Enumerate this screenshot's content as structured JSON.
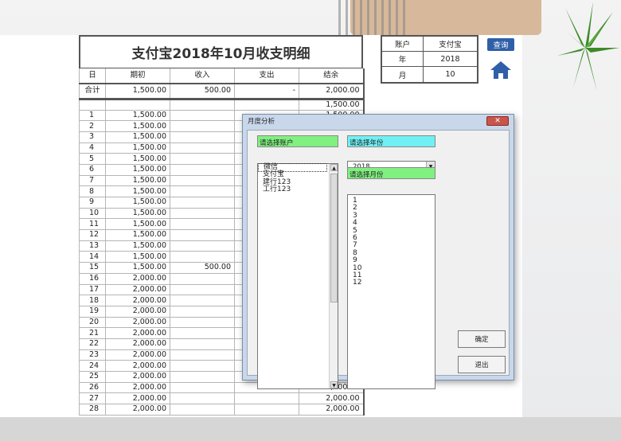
{
  "sheet": {
    "title": "支付宝2018年10月收支明细",
    "headers": [
      "日",
      "期初",
      "收入",
      "支出",
      "结余"
    ],
    "summary": {
      "label": "合计",
      "opening": "1,500.00",
      "income": "500.00",
      "expense": "-",
      "balance": "2,000.00"
    },
    "blank_row_balance": "1,500.00",
    "rows": [
      {
        "day": "1",
        "opening": "1,500.00",
        "income": "",
        "balance": "1,500.00"
      },
      {
        "day": "2",
        "opening": "1,500.00",
        "income": "",
        "balance": ""
      },
      {
        "day": "3",
        "opening": "1,500.00",
        "income": "",
        "balance": ""
      },
      {
        "day": "4",
        "opening": "1,500.00",
        "income": "",
        "balance": ""
      },
      {
        "day": "5",
        "opening": "1,500.00",
        "income": "",
        "balance": ""
      },
      {
        "day": "6",
        "opening": "1,500.00",
        "income": "",
        "balance": ""
      },
      {
        "day": "7",
        "opening": "1,500.00",
        "income": "",
        "balance": ""
      },
      {
        "day": "8",
        "opening": "1,500.00",
        "income": "",
        "balance": ""
      },
      {
        "day": "9",
        "opening": "1,500.00",
        "income": "",
        "balance": ""
      },
      {
        "day": "10",
        "opening": "1,500.00",
        "income": "",
        "balance": ""
      },
      {
        "day": "11",
        "opening": "1,500.00",
        "income": "",
        "balance": ""
      },
      {
        "day": "12",
        "opening": "1,500.00",
        "income": "",
        "balance": ""
      },
      {
        "day": "13",
        "opening": "1,500.00",
        "income": "",
        "balance": ""
      },
      {
        "day": "14",
        "opening": "1,500.00",
        "income": "",
        "balance": ""
      },
      {
        "day": "15",
        "opening": "1,500.00",
        "income": "500.00",
        "balance": ""
      },
      {
        "day": "16",
        "opening": "2,000.00",
        "income": "",
        "balance": ""
      },
      {
        "day": "17",
        "opening": "2,000.00",
        "income": "",
        "balance": ""
      },
      {
        "day": "18",
        "opening": "2,000.00",
        "income": "",
        "balance": ""
      },
      {
        "day": "19",
        "opening": "2,000.00",
        "income": "",
        "balance": ""
      },
      {
        "day": "20",
        "opening": "2,000.00",
        "income": "",
        "balance": ""
      },
      {
        "day": "21",
        "opening": "2,000.00",
        "income": "",
        "balance": ""
      },
      {
        "day": "22",
        "opening": "2,000.00",
        "income": "",
        "balance": ""
      },
      {
        "day": "23",
        "opening": "2,000.00",
        "income": "",
        "balance": ""
      },
      {
        "day": "24",
        "opening": "2,000.00",
        "income": "",
        "balance": ""
      },
      {
        "day": "25",
        "opening": "2,000.00",
        "income": "",
        "balance": ""
      },
      {
        "day": "26",
        "opening": "2,000.00",
        "income": "",
        "balance": "2,000.00"
      },
      {
        "day": "27",
        "opening": "2,000.00",
        "income": "",
        "balance": "2,000.00"
      },
      {
        "day": "28",
        "opening": "2,000.00",
        "income": "",
        "balance": "2,000.00"
      }
    ]
  },
  "info": {
    "account_label": "账户",
    "account_value": "支付宝",
    "year_label": "年",
    "year_value": "2018",
    "month_label": "月",
    "month_value": "10"
  },
  "toolbar": {
    "query_label": "查询",
    "home_icon": "home-icon"
  },
  "dialog": {
    "title": "月度分析",
    "close_glyph": "✕",
    "account_label": "请选择账户",
    "accounts": [
      "微信",
      "支付宝",
      "建行123",
      "工行123"
    ],
    "year_label": "请选择年份",
    "year_value": "2018",
    "month_label": "请选择月份",
    "months": [
      "1",
      "2",
      "3",
      "4",
      "5",
      "6",
      "7",
      "8",
      "9",
      "10",
      "11",
      "12"
    ],
    "ok_label": "确定",
    "exit_label": "退出"
  },
  "colors": {
    "accent": "#2f5fa8",
    "green_label": "#80f080",
    "cyan_label": "#70f0f4"
  }
}
